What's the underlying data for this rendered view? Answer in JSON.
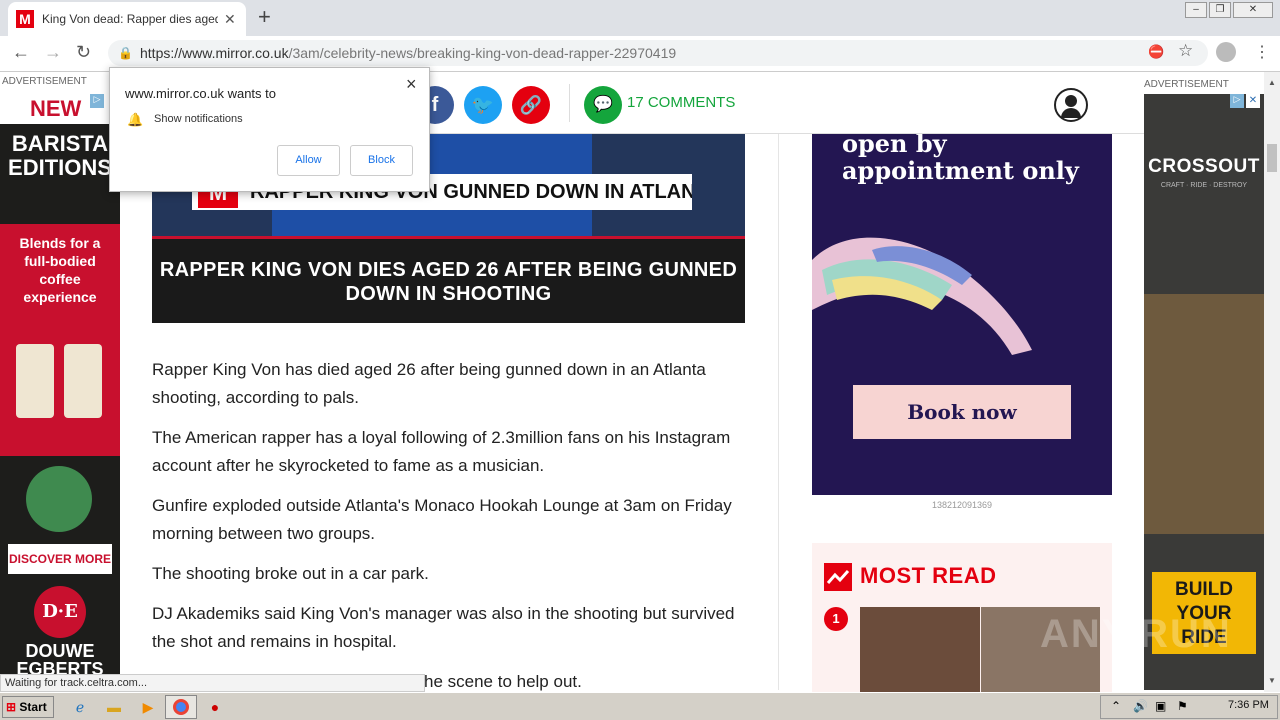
{
  "browser": {
    "tab_title": "King Von dead: Rapper dies aged 26",
    "tab_favicon": "M",
    "url_domain": "https://www.mirror.co.uk",
    "url_path": "/3am/celebrity-news/breaking-king-von-dead-rapper-22970419",
    "status_text": "Waiting for track.celtra.com..."
  },
  "popup": {
    "heading": "www.mirror.co.uk wants to",
    "permission": "Show notifications",
    "allow_label": "Allow",
    "block_label": "Block"
  },
  "sharebar": {
    "comments": "17 COMMENTS"
  },
  "hero": {
    "image_banner": "RAPPER KING VON GUNNED DOWN IN ATLANTA SHOOTING",
    "caption": "RAPPER KING VON DIES AGED 26 AFTER BEING GUNNED DOWN IN SHOOTING"
  },
  "article": {
    "paragraphs": [
      "Rapper King Von has died aged 26 after being gunned down in an Atlanta shooting, according to pals.",
      "The American rapper has a loyal following of 2.3million fans on his Instagram account after he skyrocketed to fame as a musician.",
      "Gunfire exploded outside Atlanta's Monaco Hookah Lounge at 3am on Friday morning between two groups.",
      "The shooting broke out in a car park.",
      "DJ Akademiks said King Von's manager was also in the shooting but survived the shot and remains in hospital.",
      "he scene to help out."
    ]
  },
  "ads": {
    "label": "ADVERTISEMENT",
    "left": {
      "new": "NEW",
      "line1": "BARISTA",
      "line2": "EDITIONS",
      "tagline": "Blends for a full-bodied coffee experience",
      "seal": "RAINFOREST ALLIANCE CERTIFIED",
      "cta": "DISCOVER MORE",
      "brand_mark": "D·E",
      "brand_name1": "DOUWE",
      "brand_name2": "EGBERTS"
    },
    "main": {
      "headline": "open by appointment only",
      "cta": "Book now",
      "id": "138212091369"
    },
    "sky": {
      "brand": "CROSSOUT",
      "tagline": "CRAFT · RIDE · DESTROY",
      "cta": "BUILD YOUR RIDE"
    }
  },
  "most_read": {
    "title": "MOST READ",
    "rank": "1"
  },
  "taskbar": {
    "start": "Start",
    "clock": "7:36 PM"
  },
  "watermark": "ANY.RUN",
  "colors": {
    "mirror_red": "#e4000f",
    "facebook": "#3b5998",
    "twitter": "#1da1f2",
    "comments_green": "#14a53c",
    "ad_purple": "#231652"
  }
}
